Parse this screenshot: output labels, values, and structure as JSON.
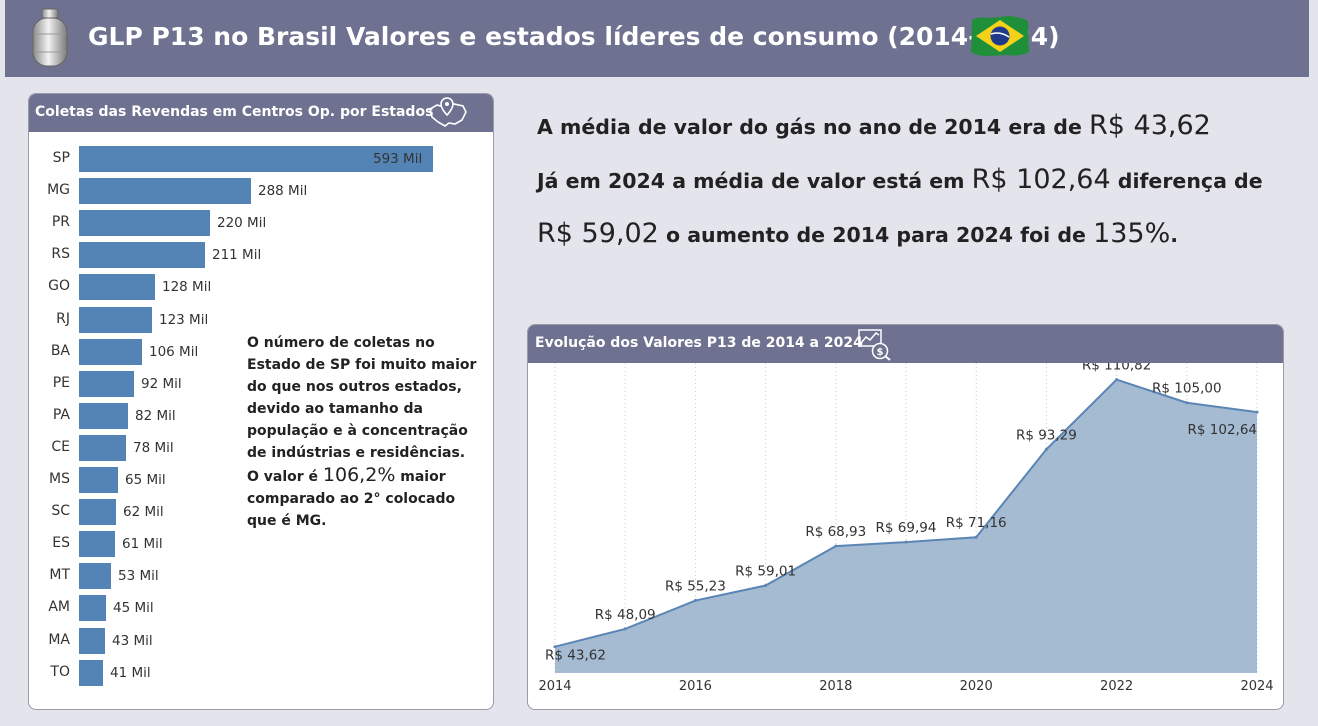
{
  "header": {
    "title": "GLP P13 no Brasil Valores e estados líderes de consumo (2014-2024)",
    "left_icon": "gas-cylinder-icon",
    "right_icon": "brazil-flag-icon"
  },
  "colors": {
    "header_bg": "#6e7190",
    "bar": "#5484b6",
    "area_fill": "#a0b7d0",
    "area_line": "#5a85b5",
    "page_bg": "#e4e4ec"
  },
  "left_panel": {
    "title": "Coletas das Revendas em Centros Op. por Estados",
    "icon": "map-pin-icon",
    "note": {
      "text": "O número de coletas no Estado de SP foi muito maior do que nos outros estados, devido ao tamanho da população e à concentração de indústrias e residências.",
      "valor_prefix": "O valor é",
      "valor_value": "106,2%",
      "valor_suffix": "maior comparado ao 2° colocado que é MG."
    }
  },
  "summary": {
    "line1_text": "A média de valor do gás no ano de 2014 era de",
    "line1_value": "R$ 43,62",
    "line2_text": "Já em 2024 a média de valor está em",
    "line2_value": "R$ 102,64",
    "line2_suffix": "diferença de",
    "line3_value": "R$ 59,02",
    "line3_text": "o aumento de 2014 para 2024 foi de",
    "line3_pct": "135%",
    "line3_end": "."
  },
  "right_panel": {
    "title": "Evolução dos Valores P13 de 2014 a 2024",
    "icon": "money-chart-icon"
  },
  "chart_data": [
    {
      "type": "bar",
      "orientation": "horizontal",
      "title": "Coletas das Revendas em Centros Op. por Estados",
      "categories": [
        "SP",
        "MG",
        "PR",
        "RS",
        "GO",
        "RJ",
        "BA",
        "PE",
        "PA",
        "CE",
        "MS",
        "SC",
        "ES",
        "MT",
        "AM",
        "MA",
        "TO"
      ],
      "values": [
        593,
        288,
        220,
        211,
        128,
        123,
        106,
        92,
        82,
        78,
        65,
        62,
        61,
        53,
        45,
        43,
        41
      ],
      "value_labels": [
        "593 Mil",
        "288 Mil",
        "220 Mil",
        "211 Mil",
        "128 Mil",
        "123 Mil",
        "106 Mil",
        "92 Mil",
        "82 Mil",
        "78 Mil",
        "65 Mil",
        "62 Mil",
        "61 Mil",
        "53 Mil",
        "45 Mil",
        "43 Mil",
        "41 Mil"
      ],
      "unit": "Mil",
      "xlim": [
        0,
        593
      ]
    },
    {
      "type": "area",
      "title": "Evolução dos Valores P13 de 2014 a 2024",
      "x": [
        2014,
        2015,
        2016,
        2017,
        2018,
        2019,
        2020,
        2021,
        2022,
        2023,
        2024
      ],
      "values": [
        43.62,
        48.09,
        55.23,
        59.01,
        68.93,
        69.94,
        71.16,
        93.29,
        110.82,
        105.0,
        102.64
      ],
      "value_labels": [
        "R$ 43,62",
        "R$ 48,09",
        "R$ 55,23",
        "R$ 59,01",
        "R$ 68,93",
        "R$ 69,94",
        "R$ 71,16",
        "R$ 93,29",
        "R$ 110,82",
        "R$ 105,00",
        "R$ 102,64"
      ],
      "x_ticks": [
        2014,
        2016,
        2018,
        2020,
        2022,
        2024
      ],
      "ylim": [
        37,
        115
      ],
      "grid": "vertical-dotted"
    }
  ]
}
